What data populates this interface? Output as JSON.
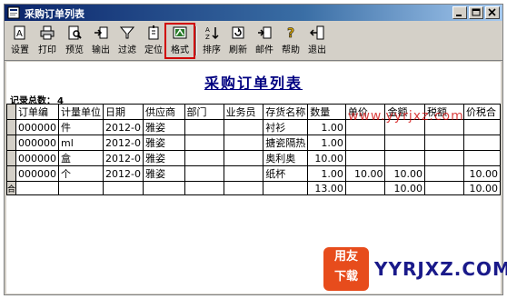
{
  "window": {
    "title": "采购订单列表",
    "buttons": [
      "minimize",
      "maximize",
      "close"
    ]
  },
  "toolbar": {
    "items": [
      {
        "label": "设置",
        "icon": "settings-icon"
      },
      {
        "label": "打印",
        "icon": "print-icon"
      },
      {
        "label": "预览",
        "icon": "preview-icon"
      },
      {
        "label": "输出",
        "icon": "export-icon"
      },
      {
        "label": "过滤",
        "icon": "filter-icon"
      },
      {
        "label": "定位",
        "icon": "locate-icon"
      },
      {
        "label": "格式",
        "icon": "format-icon",
        "highlighted": true
      },
      {
        "label": "排序",
        "icon": "sort-icon"
      },
      {
        "label": "刷新",
        "icon": "refresh-icon"
      },
      {
        "label": "邮件",
        "icon": "mail-icon"
      },
      {
        "label": "帮助",
        "icon": "help-icon"
      },
      {
        "label": "退出",
        "icon": "exit-icon"
      }
    ]
  },
  "report": {
    "title": "采购订单列表",
    "record_count_label": "记录总数：",
    "record_count": "4"
  },
  "table": {
    "headers": [
      "订单编",
      "计量单位",
      "日期",
      "供应商",
      "部门",
      "业务员",
      "存货名称",
      "数量",
      "单价",
      "金额",
      "税额",
      "价税合"
    ],
    "rows": [
      [
        "000000",
        "件",
        "2012-0",
        "雅姿",
        "",
        "",
        "衬衫",
        "1.00",
        "",
        "",
        "",
        ""
      ],
      [
        "000000",
        "ml",
        "2012-0",
        "雅姿",
        "",
        "",
        "搪瓷隔热",
        "1.00",
        "",
        "",
        "",
        ""
      ],
      [
        "000000",
        "盒",
        "2012-0",
        "雅姿",
        "",
        "",
        "奥利奥",
        "10.00",
        "",
        "",
        "",
        ""
      ],
      [
        "000000",
        "个",
        "2012-0",
        "雅姿",
        "",
        "",
        "纸杯",
        "1.00",
        "10.00",
        "10.00",
        "",
        "10.00"
      ]
    ],
    "total_row": {
      "marker": "合",
      "cells": [
        "",
        "",
        "",
        "",
        "",
        "",
        "",
        "13.00",
        "",
        "10.00",
        "",
        "10.00"
      ]
    }
  },
  "watermark": {
    "text": "www.yyrjxz.com",
    "color": "#d00000"
  },
  "logo": {
    "badge_text_1": "用友",
    "badge_text_2": "下载",
    "site_text": "YYRJXZ.COM",
    "badge_color": "#e74c1c"
  }
}
